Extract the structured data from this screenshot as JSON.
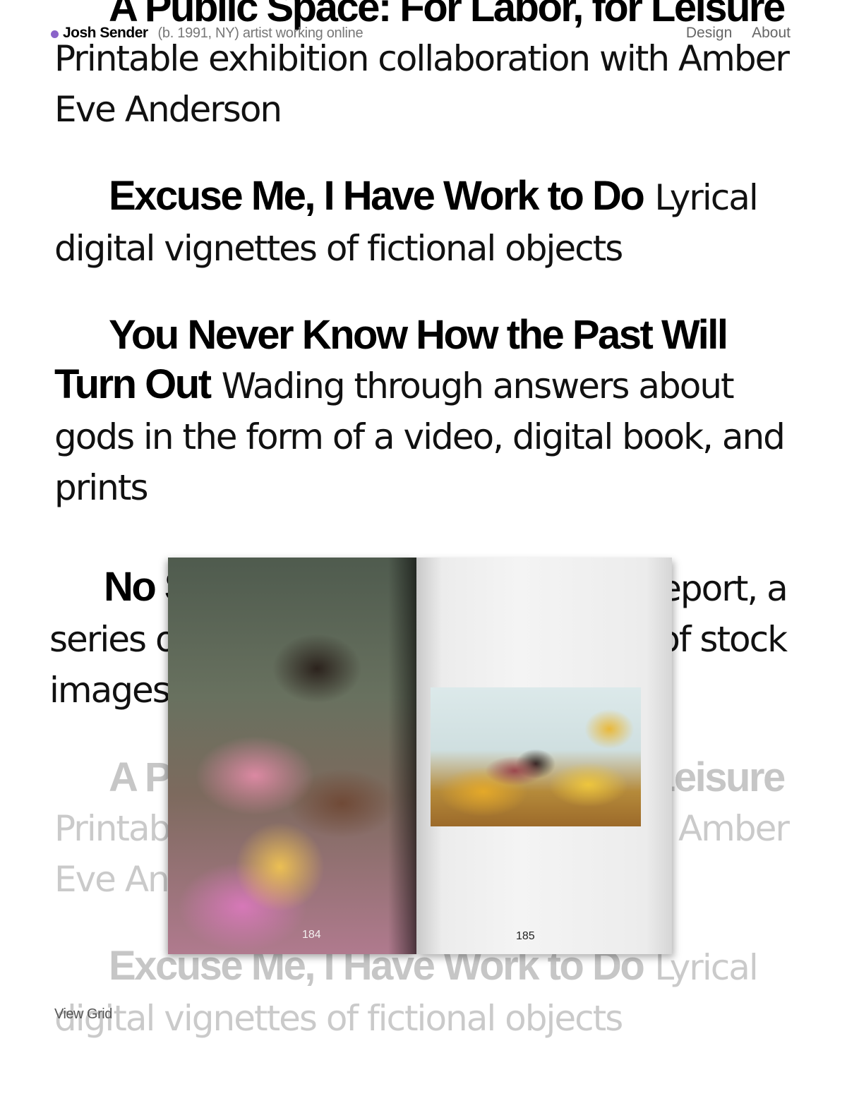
{
  "header": {
    "name": "Josh Sender",
    "bio": "(b. 1991, NY) artist working online",
    "nav": {
      "design": "Design",
      "about": "About"
    }
  },
  "projects": [
    {
      "title": "A Public Space: For Labor, for Leisure",
      "desc": "Printable exhibition collaboration with Amber Eve Anderson"
    },
    {
      "title": "Excuse Me, I Have Work to Do",
      "desc": "Lyrical digital vignettes of fictional objects"
    },
    {
      "title": "You Never Know How the Past Will Turn Out",
      "desc": "Wading through answers about gods in the form of a video, digital book, and prints"
    },
    {
      "title": "No Shortage of Bodies",
      "desc": "Culture report, a series of paintings, and an exhibition of stock images"
    }
  ],
  "book": {
    "page_left": "184",
    "page_right": "185"
  },
  "footer": {
    "view_grid": "View Grid"
  },
  "colors": {
    "brand_dot": "#8a63c9",
    "muted_text": "#777777"
  }
}
